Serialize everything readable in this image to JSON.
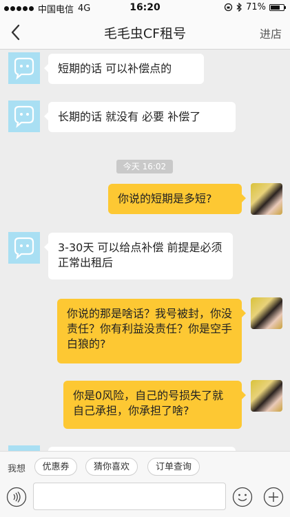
{
  "status": {
    "carrier": "中国电信",
    "network": "4G",
    "time": "16:20",
    "battery": "71%",
    "battery_level": 0.71
  },
  "nav": {
    "title": "毛毛虫CF租号",
    "right_label": "进店"
  },
  "messages": [
    {
      "text": "短期的话 可以补偿点的"
    },
    {
      "text": "长期的话 就没有 必要 补偿了"
    },
    {
      "text": "你说的短期是多短?"
    },
    {
      "text": "3-30天 可以给点补偿 前提是必须正常出租后"
    },
    {
      "text": "你说的那是啥话？我号被封，你没责任？你有利益没责任？你是空手白狼的?"
    },
    {
      "text": "你是0风险，自己的号损失了就自己承担，你承担了啥?"
    }
  ],
  "timestamp": "今天 16:02",
  "quick_bar": {
    "label": "我想",
    "chips": [
      "优惠券",
      "猜你喜欢",
      "订单查询"
    ]
  },
  "input": {
    "placeholder": ""
  },
  "colors": {
    "bubble_user": "#fdc833",
    "bubble_other": "#ffffff",
    "bot_avatar": "#a9dff3",
    "background": "#ededed"
  }
}
